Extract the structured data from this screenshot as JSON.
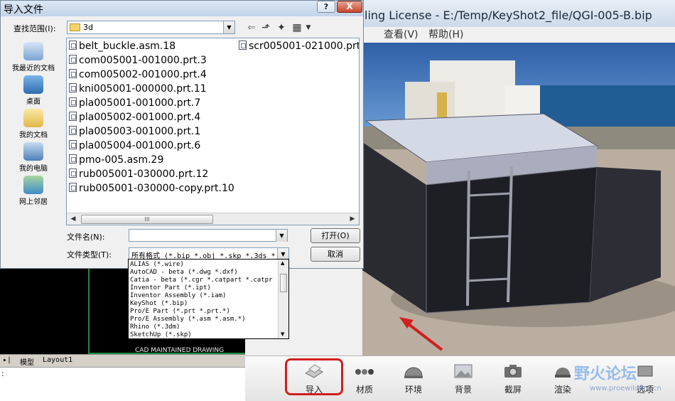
{
  "keyshot": {
    "title": "ling License  -  E:/Temp/KeyShot2_file/QGI-005-B.bip",
    "menu": [
      "查看(V)",
      "帮助(H)"
    ],
    "toolbar": [
      {
        "label": "导入",
        "icon": "import-icon"
      },
      {
        "label": "材质",
        "icon": "materials-icon"
      },
      {
        "label": "环境",
        "icon": "environment-icon"
      },
      {
        "label": "背景",
        "icon": "background-icon"
      },
      {
        "label": "截屏",
        "icon": "screenshot-icon"
      },
      {
        "label": "渲染",
        "icon": "render-icon"
      },
      {
        "label": "选项",
        "icon": "options-icon"
      }
    ],
    "watermark": "野火论坛",
    "watermark_url": "www.proewildfire.cn",
    "highlight_color": "#d21f1f"
  },
  "cad": {
    "caption": "CAD MAINTAINED DRAWING",
    "tabs": [
      "模型",
      "Layout1"
    ],
    "cmd_prompt": ":"
  },
  "dialog": {
    "title": "导入文件",
    "help_label": "?",
    "close_label": "X",
    "lookin_label": "查找范围(I):",
    "lookin_value": "3d",
    "places": [
      {
        "label": "我最近的文档",
        "icon": "recent-documents-icon"
      },
      {
        "label": "桌面",
        "icon": "desktop-icon"
      },
      {
        "label": "我的文档",
        "icon": "my-documents-icon"
      },
      {
        "label": "我的电脑",
        "icon": "my-computer-icon"
      },
      {
        "label": "网上邻居",
        "icon": "network-places-icon"
      }
    ],
    "files_col1": [
      "belt_buckle.asm.18",
      "com005001-001000.prt.3",
      "com005002-001000.prt.4",
      "kni005001-000000.prt.11",
      "pla005001-001000.prt.7",
      "pla005002-001000.prt.4",
      "pla005003-001000.prt.1",
      "pla005004-001000.prt.6",
      "pmo-005.asm.29",
      "rub005001-030000.prt.12",
      "rub005001-030000-copy.prt.10"
    ],
    "files_col2": [
      "scr005001-021000.prt."
    ],
    "scroll_thumb": "III",
    "filename_label": "文件名(N):",
    "filename_value": "",
    "filetype_label": "文件类型(T):",
    "filetype_value": "所有格式 (*.bip *.obj *.skp *.3ds *.f",
    "open_label": "打开(O)",
    "cancel_label": "取消",
    "filetype_options": [
      "ALIAS (*.wire)",
      "AutoCAD - beta (*.dwg *.dxf)",
      "Catia - beta (*.cgr *.catpart *.catpr",
      "Inventor Part (*.ipt)",
      "Inventor Assembly (*.iam)",
      "KeyShot (*.bip)",
      "Pro/E Part (*.prt *.prt.*)",
      "Pro/E Assembly (*.asm *.asm.*)",
      "Rhino (*.3dm)",
      "SketchUp (*.skp)"
    ]
  }
}
